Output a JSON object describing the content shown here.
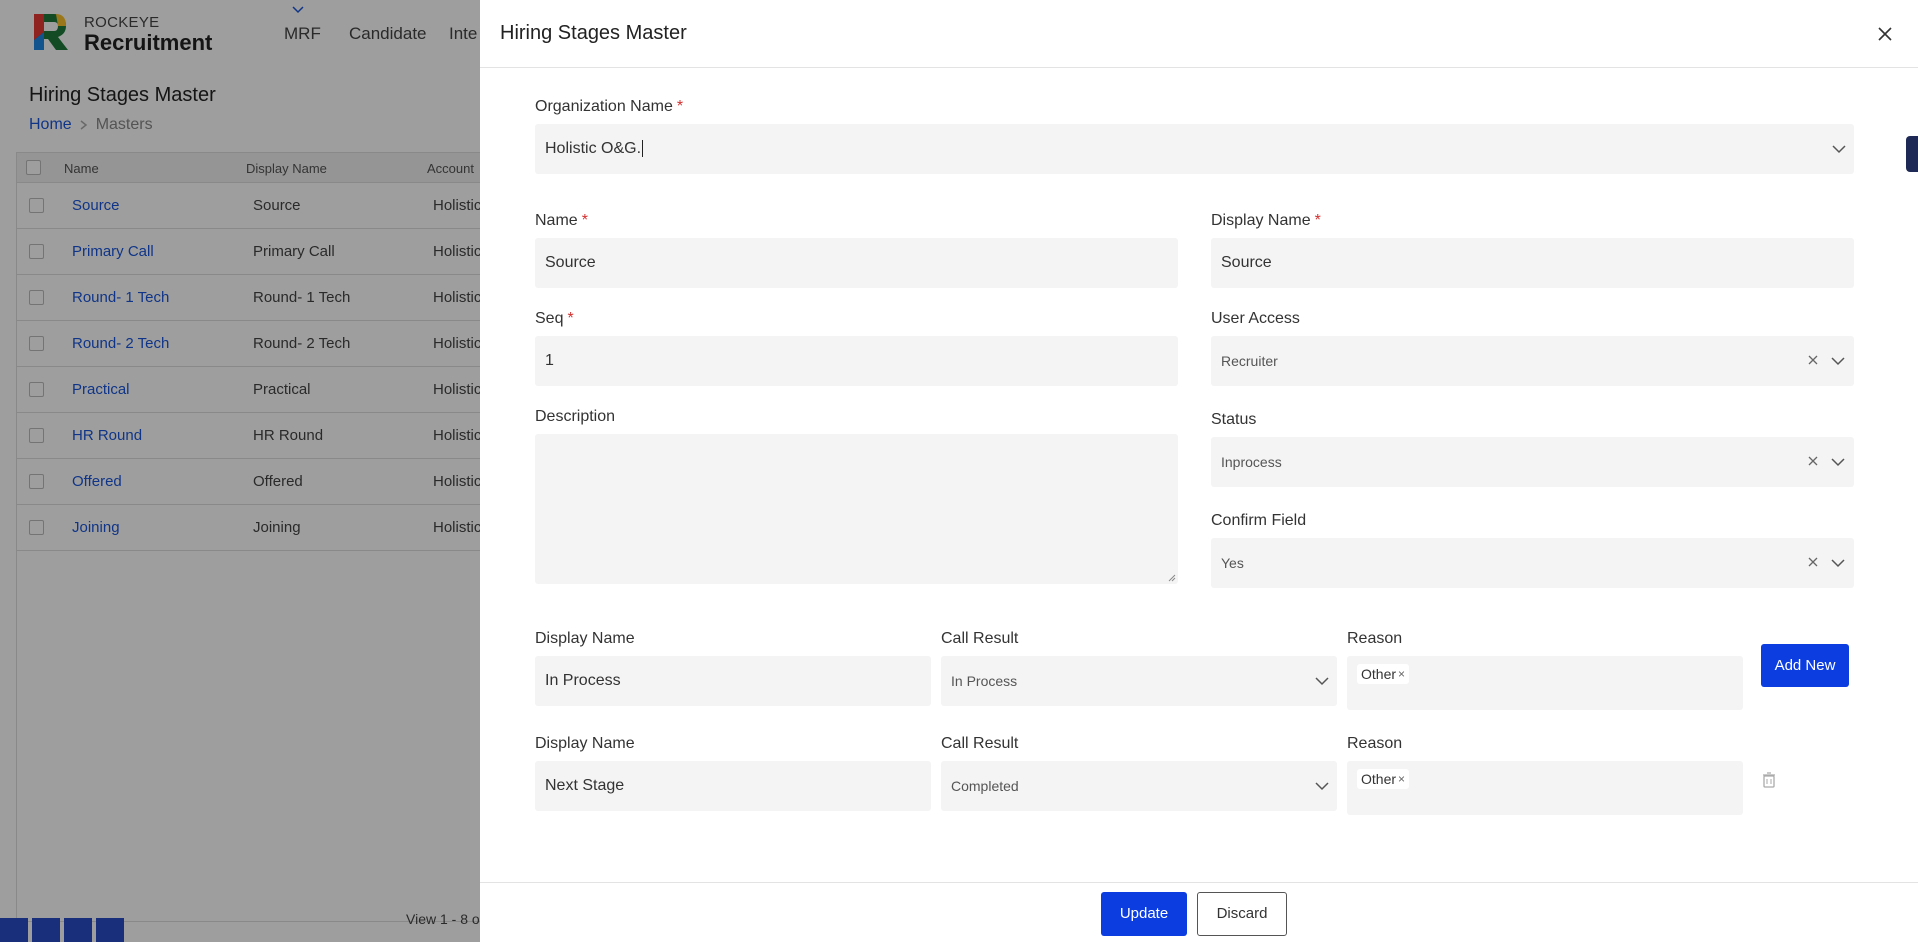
{
  "app": {
    "brand_top": "ROCKEYE",
    "brand_main": "Recruitment",
    "nav": [
      "MRF",
      "Candidate",
      "Inte"
    ],
    "page_title": "Hiring Stages Master",
    "breadcrumb": {
      "home": "Home",
      "current": "Masters"
    },
    "grid": {
      "columns": [
        "Name",
        "Display Name",
        "Account"
      ],
      "rows": [
        {
          "name": "Source",
          "display": "Source",
          "account": "Holistic"
        },
        {
          "name": "Primary Call",
          "display": "Primary Call",
          "account": "Holistic"
        },
        {
          "name": "Round- 1 Tech",
          "display": "Round- 1 Tech",
          "account": "Holistic"
        },
        {
          "name": "Round- 2 Tech",
          "display": "Round- 2 Tech",
          "account": "Holistic"
        },
        {
          "name": "Practical",
          "display": "Practical",
          "account": "Holistic"
        },
        {
          "name": "HR Round",
          "display": "HR Round",
          "account": "Holistic"
        },
        {
          "name": "Offered",
          "display": "Offered",
          "account": "Holistic"
        },
        {
          "name": "Joining",
          "display": "Joining",
          "account": "Holistic"
        }
      ],
      "footer": "View 1 - 8 o"
    }
  },
  "drawer": {
    "title": "Hiring Stages Master",
    "org_label": "Organization Name",
    "org_value": "Holistic O&G.",
    "name_label": "Name",
    "name_value": "Source",
    "display_name_label": "Display Name",
    "display_name_value": "Source",
    "seq_label": "Seq",
    "seq_value": "1",
    "user_access_label": "User Access",
    "user_access_value": "Recruiter",
    "description_label": "Description",
    "description_value": "",
    "status_label": "Status",
    "status_value": "Inprocess",
    "confirm_label": "Confirm Field",
    "confirm_value": "Yes",
    "required_mark": "*",
    "stages": [
      {
        "display_label": "Display Name",
        "display_value": "In Process",
        "call_label": "Call Result",
        "call_value": "In Process",
        "reason_label": "Reason",
        "reason_tag": "Other"
      },
      {
        "display_label": "Display Name",
        "display_value": "Next Stage",
        "call_label": "Call Result",
        "call_value": "Completed",
        "reason_label": "Reason",
        "reason_tag": "Other"
      }
    ],
    "add_new_label": "Add New",
    "update_label": "Update",
    "discard_label": "Discard",
    "tag_remove": "×"
  },
  "colors": {
    "primary": "#0b3de0",
    "link": "#1a56db",
    "required": "#d32f2f",
    "field_bg": "#f4f4f4"
  }
}
